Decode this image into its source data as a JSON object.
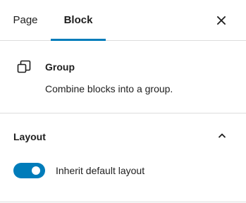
{
  "tabs": {
    "items": [
      {
        "label": "Page",
        "active": false
      },
      {
        "label": "Block",
        "active": true
      }
    ],
    "accent_color": "#007cba"
  },
  "close": {
    "icon": "close-icon"
  },
  "block_card": {
    "icon": "group-icon",
    "title": "Group",
    "description": "Combine blocks into a group."
  },
  "layout_panel": {
    "title": "Layout",
    "expanded": true,
    "chevron_icon": "chevron-up-icon",
    "toggle": {
      "label": "Inherit default layout",
      "checked": true,
      "color": "#007cba"
    }
  }
}
